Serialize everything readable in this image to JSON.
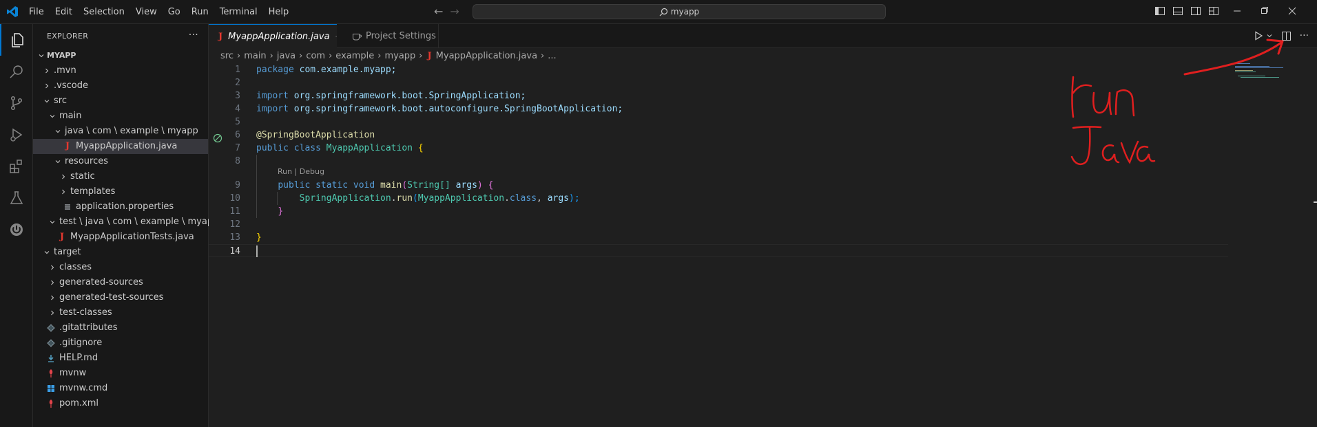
{
  "titlebar": {
    "menu": [
      "File",
      "Edit",
      "Selection",
      "View",
      "Go",
      "Run",
      "Terminal",
      "Help"
    ],
    "search_text": "myapp"
  },
  "explorer": {
    "title": "EXPLORER",
    "more": "···",
    "root": "MYAPP",
    "items": [
      {
        "label": ".mvn",
        "depth": 1,
        "kind": "folder-closed"
      },
      {
        "label": ".vscode",
        "depth": 1,
        "kind": "folder-closed"
      },
      {
        "label": "src",
        "depth": 1,
        "kind": "folder-open"
      },
      {
        "label": "main",
        "depth": 2,
        "kind": "folder-open"
      },
      {
        "label": "java \\ com \\ example \\ myapp",
        "depth": 3,
        "kind": "folder-open"
      },
      {
        "label": "MyappApplication.java",
        "depth": 4,
        "kind": "java",
        "selected": true
      },
      {
        "label": "resources",
        "depth": 3,
        "kind": "folder-open"
      },
      {
        "label": "static",
        "depth": 4,
        "kind": "folder-closed"
      },
      {
        "label": "templates",
        "depth": 4,
        "kind": "folder-closed"
      },
      {
        "label": "application.properties",
        "depth": 4,
        "kind": "properties"
      },
      {
        "label": "test \\ java \\ com \\ example \\ myapp",
        "depth": 2,
        "kind": "folder-open"
      },
      {
        "label": "MyappApplicationTests.java",
        "depth": 3,
        "kind": "java"
      },
      {
        "label": "target",
        "depth": 1,
        "kind": "folder-open"
      },
      {
        "label": "classes",
        "depth": 2,
        "kind": "folder-closed"
      },
      {
        "label": "generated-sources",
        "depth": 2,
        "kind": "folder-closed"
      },
      {
        "label": "generated-test-sources",
        "depth": 2,
        "kind": "folder-closed"
      },
      {
        "label": "test-classes",
        "depth": 2,
        "kind": "folder-closed"
      },
      {
        "label": ".gitattributes",
        "depth": 1,
        "kind": "git"
      },
      {
        "label": ".gitignore",
        "depth": 1,
        "kind": "git"
      },
      {
        "label": "HELP.md",
        "depth": 1,
        "kind": "markdown"
      },
      {
        "label": "mvnw",
        "depth": 1,
        "kind": "maven"
      },
      {
        "label": "mvnw.cmd",
        "depth": 1,
        "kind": "windows"
      },
      {
        "label": "pom.xml",
        "depth": 1,
        "kind": "maven"
      }
    ]
  },
  "tabs": [
    {
      "label": "MyappApplication.java",
      "active": true,
      "icon": "java-icon"
    },
    {
      "label": "Project Settings",
      "active": false,
      "icon": "settings-cup-icon"
    }
  ],
  "breadcrumb": [
    "src",
    "main",
    "java",
    "com",
    "example",
    "myapp",
    "MyappApplication.java",
    "..."
  ],
  "editor": {
    "line_numbers": [
      "1",
      "2",
      "3",
      "4",
      "5",
      "6",
      "7",
      "8",
      "9",
      "10",
      "11",
      "12",
      "13",
      "14"
    ],
    "current_line": "14",
    "codelens": "Run | Debug",
    "code": {
      "l1_kw": "package",
      "l1_rest": "com.example.myapp;",
      "l3_kw": "import",
      "l3_pkg": "org.springframework.boot.SpringApplication;",
      "l4_kw": "import",
      "l4_pkg": "org.springframework.boot.autoconfigure.SpringBootApplication;",
      "l6_annot": "@SpringBootApplication",
      "l7_kw": "public class",
      "l7_name": "MyappApplication",
      "l7_brace": "{",
      "l9_mod": "public static void",
      "l9_fn": "main",
      "l9_p1": "(",
      "l9_type": "String[]",
      "l9_arg": "args",
      "l9_p2": ")",
      "l9_brace": "{",
      "l10_cls": "SpringApplication",
      "l10_dot": ".",
      "l10_fn": "run",
      "l10_p1": "(",
      "l10_ref": "MyappApplication",
      "l10_dot2": ".",
      "l10_kw": "class",
      "l10_comma": ",",
      "l10_arg": "args",
      "l10_p2": ");",
      "l11_brace": "}",
      "l13_brace": "}"
    }
  },
  "annotation": {
    "line1": "run",
    "line2": "Java",
    "color": "#e01f1f"
  },
  "colors": {
    "accent": "#0078d4",
    "java_icon": "#e5382f"
  }
}
